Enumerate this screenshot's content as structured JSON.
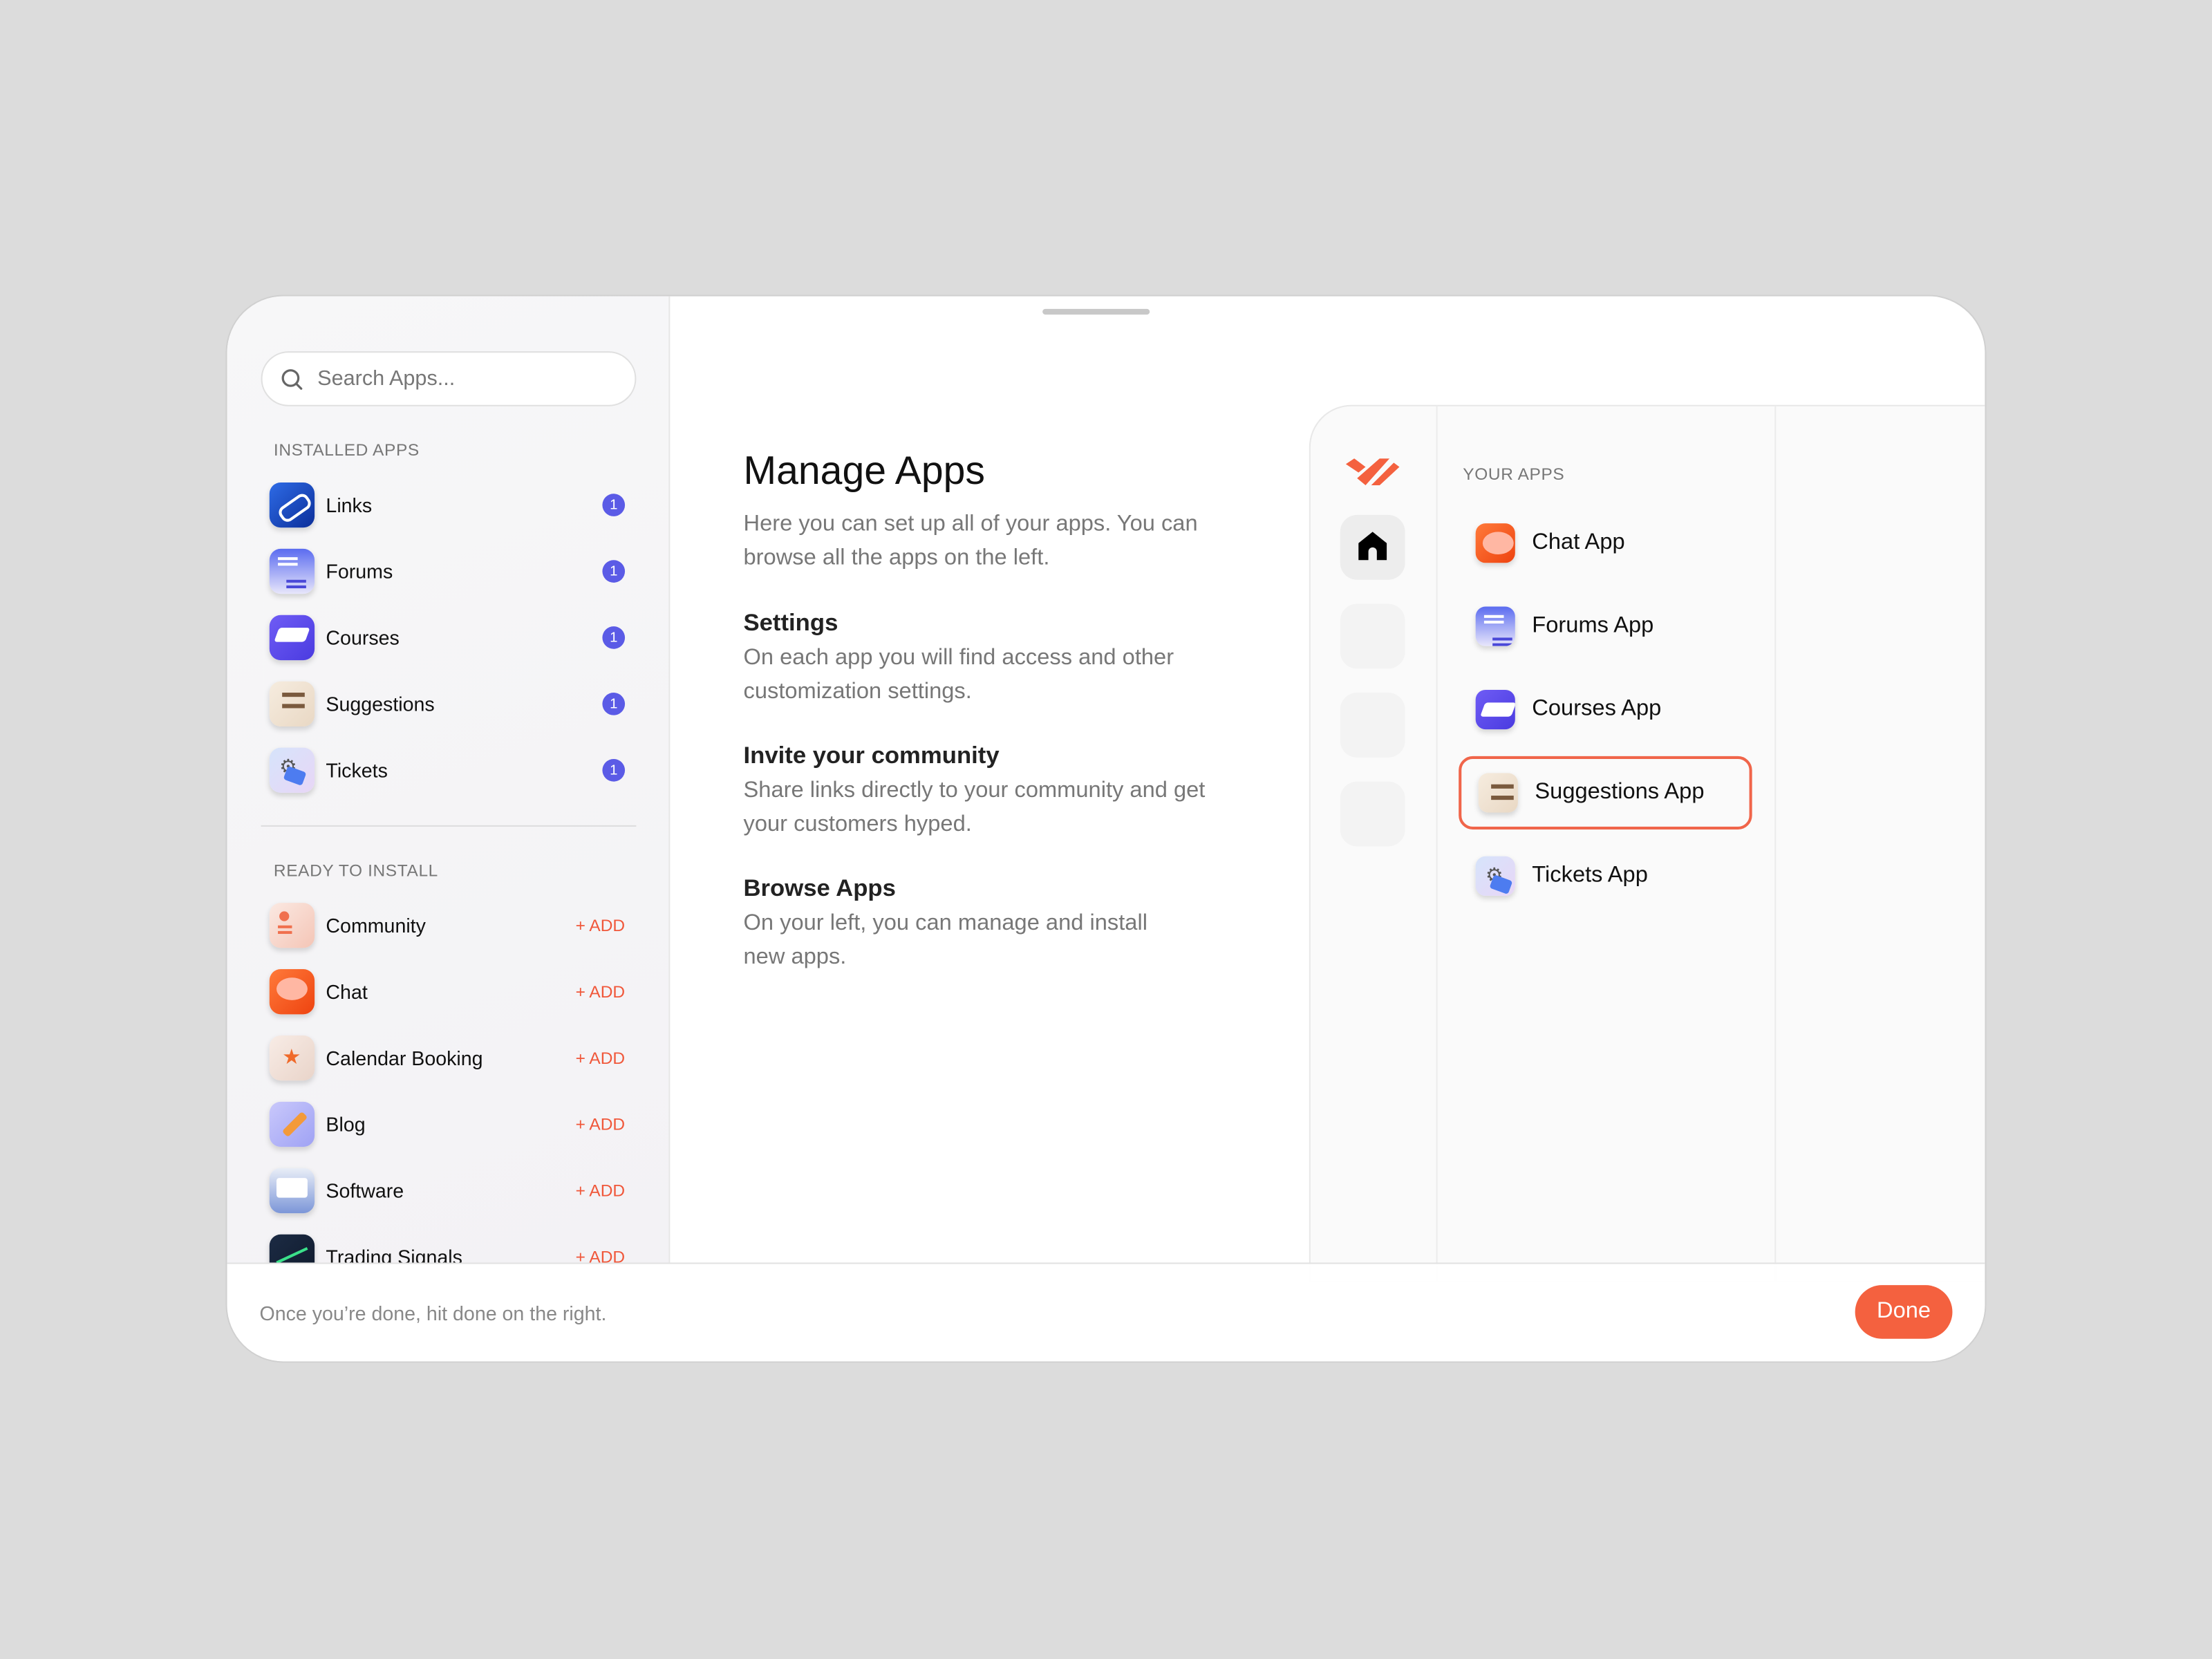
{
  "sidebar": {
    "search_placeholder": "Search Apps...",
    "installed_title": "INSTALLED APPS",
    "installed": [
      {
        "label": "Links",
        "badge": "1",
        "icon": "links-icon"
      },
      {
        "label": "Forums",
        "badge": "1",
        "icon": "forums-icon"
      },
      {
        "label": "Courses",
        "badge": "1",
        "icon": "courses-icon"
      },
      {
        "label": "Suggestions",
        "badge": "1",
        "icon": "suggestions-icon"
      },
      {
        "label": "Tickets",
        "badge": "1",
        "icon": "tickets-icon"
      }
    ],
    "ready_title": "READY TO INSTALL",
    "add_label": "+ ADD",
    "ready": [
      {
        "label": "Community",
        "icon": "community-icon"
      },
      {
        "label": "Chat",
        "icon": "chat-icon"
      },
      {
        "label": "Calendar Booking",
        "icon": "calendar-booking-icon"
      },
      {
        "label": "Blog",
        "icon": "blog-icon"
      },
      {
        "label": "Software",
        "icon": "software-icon"
      },
      {
        "label": "Trading Signals",
        "icon": "trading-signals-icon"
      }
    ]
  },
  "main": {
    "title": "Manage Apps",
    "intro": "Here you can set up all of your apps. You can browse all the apps on the left.",
    "sections": [
      {
        "heading": "Settings",
        "text": "On each app you will find access and other customization settings."
      },
      {
        "heading": "Invite your community",
        "text": "Share links directly to your community and get your customers hyped."
      },
      {
        "heading": "Browse Apps",
        "text": "On your left, you can manage and install new apps."
      }
    ]
  },
  "preview": {
    "your_apps_title": "YOUR APPS",
    "apps": [
      {
        "label": "Chat App",
        "selected": false
      },
      {
        "label": "Forums App",
        "selected": false
      },
      {
        "label": "Courses App",
        "selected": false
      },
      {
        "label": "Suggestions App",
        "selected": true
      },
      {
        "label": "Tickets App",
        "selected": false
      }
    ]
  },
  "footer": {
    "message": "Once you’re done, hit done on the right.",
    "done_label": "Done"
  },
  "colors": {
    "accent": "#f4613f",
    "badge": "#5b5be6",
    "selection": "#f0654a"
  }
}
